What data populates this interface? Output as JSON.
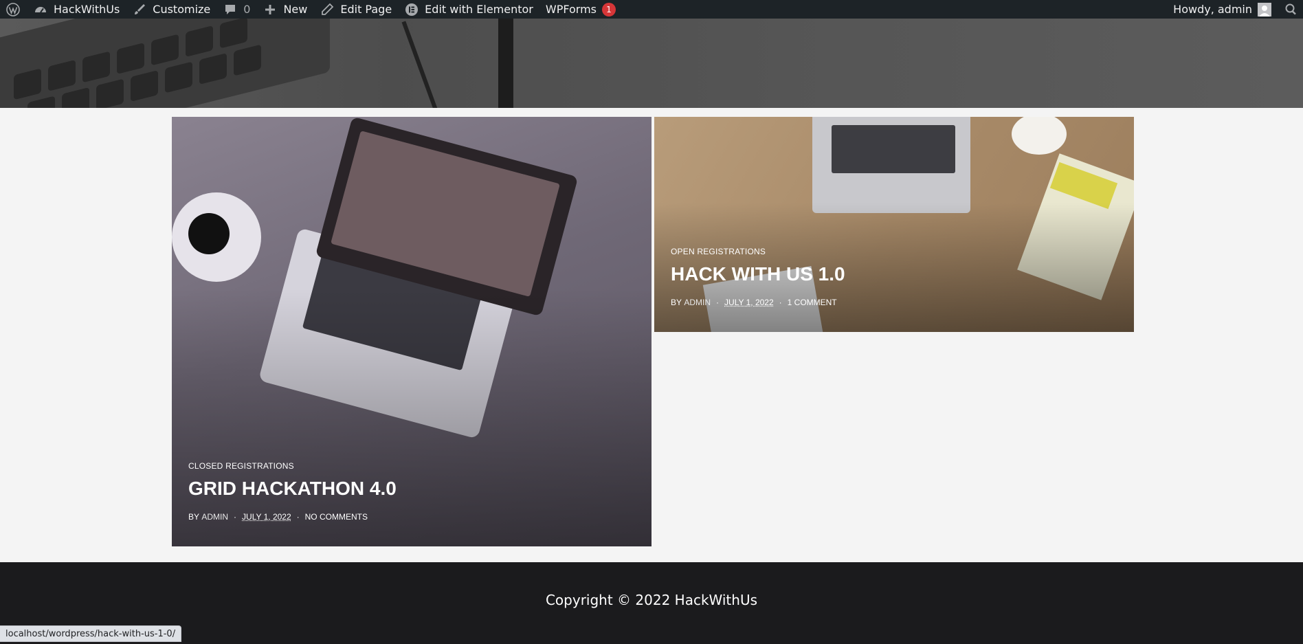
{
  "adminbar": {
    "site_name": "HackWithUs",
    "customize": "Customize",
    "comments_count": "0",
    "new": "New",
    "edit_page": "Edit Page",
    "elementor": "Edit with Elementor",
    "wpforms": "WPForms",
    "wpforms_badge": "1",
    "howdy": "Howdy, admin"
  },
  "posts": [
    {
      "category": "CLOSED REGISTRATIONS",
      "title": "GRID HACKATHON 4.0",
      "by": "BY",
      "author": "ADMIN",
      "sep": "·",
      "date": "JULY 1, 2022",
      "comments": "NO COMMENTS"
    },
    {
      "category": "OPEN REGISTRATIONS",
      "title": "HACK WITH US 1.0",
      "by": "BY",
      "author": "ADMIN",
      "sep": "·",
      "date": "JULY 1, 2022",
      "comments": "1 COMMENT"
    }
  ],
  "footer": {
    "copyright": "Copyright © 2022 HackWithUs"
  },
  "status_bar": {
    "url": "localhost/wordpress/hack-with-us-1-0/"
  },
  "colors": {
    "adminbar_bg": "#1d2327",
    "badge_red": "#d63638",
    "footer_bg": "#1b1b1d",
    "page_bg": "#f4f4f4"
  }
}
